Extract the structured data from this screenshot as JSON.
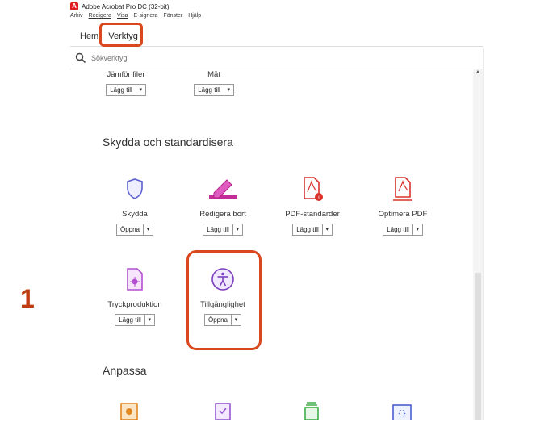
{
  "window": {
    "title": "Adobe Acrobat Pro DC (32-bit)",
    "logo_letter": "A"
  },
  "menu": [
    "Arkiv",
    "Redigera",
    "Visa",
    "E-signera",
    "Fönster",
    "Hjälp"
  ],
  "tabs": {
    "home": "Hem",
    "tools": "Verktyg"
  },
  "search": {
    "placeholder": "Sökverktyg"
  },
  "top_tools": [
    {
      "label": "Jämför filer",
      "button": "Lägg till"
    },
    {
      "label": "Mät",
      "button": "Lägg till"
    }
  ],
  "section_protect": {
    "title": "Skydda och standardisera",
    "tools": [
      {
        "label": "Skydda",
        "button": "Öppna",
        "icon": "shield-icon"
      },
      {
        "label": "Redigera bort",
        "button": "Lägg till",
        "icon": "redact-icon"
      },
      {
        "label": "PDF-standarder",
        "button": "Lägg till",
        "icon": "pdf-standards-icon"
      },
      {
        "label": "Optimera PDF",
        "button": "Lägg till",
        "icon": "optimize-pdf-icon"
      },
      {
        "label": "Tryckproduktion",
        "button": "Lägg till",
        "icon": "print-production-icon"
      },
      {
        "label": "Tillgänglighet",
        "button": "Öppna",
        "icon": "accessibility-icon"
      }
    ]
  },
  "section_customize": {
    "title": "Anpassa"
  },
  "annotation": {
    "step": "1"
  },
  "colors": {
    "highlight": "#d9481e",
    "step": "#c03d12",
    "accent_purple": "#7b3fbf",
    "accent_red": "#d9322b"
  }
}
